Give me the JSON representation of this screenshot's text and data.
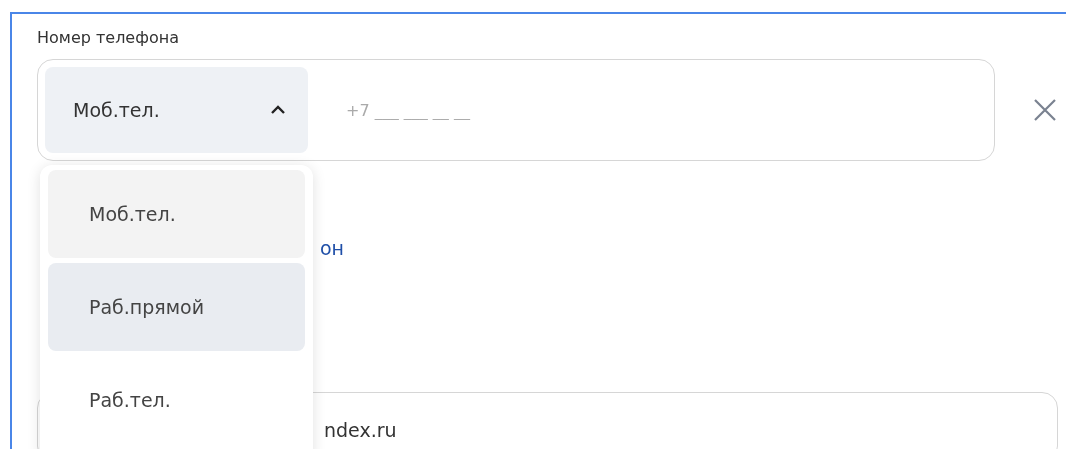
{
  "phone": {
    "label": "Номер телефона",
    "type_select": {
      "value": "Моб.тел.",
      "expanded": true
    },
    "placeholder": "+7 ___ ___ __ __"
  },
  "dropdown": {
    "options": [
      {
        "label": "Моб.тел.",
        "selected": true,
        "hovered": false
      },
      {
        "label": "Раб.прямой",
        "selected": false,
        "hovered": true
      },
      {
        "label": "Раб.тел.",
        "selected": false,
        "hovered": false
      }
    ]
  },
  "add_link": "он",
  "email_field": {
    "value": "ndex.ru"
  }
}
